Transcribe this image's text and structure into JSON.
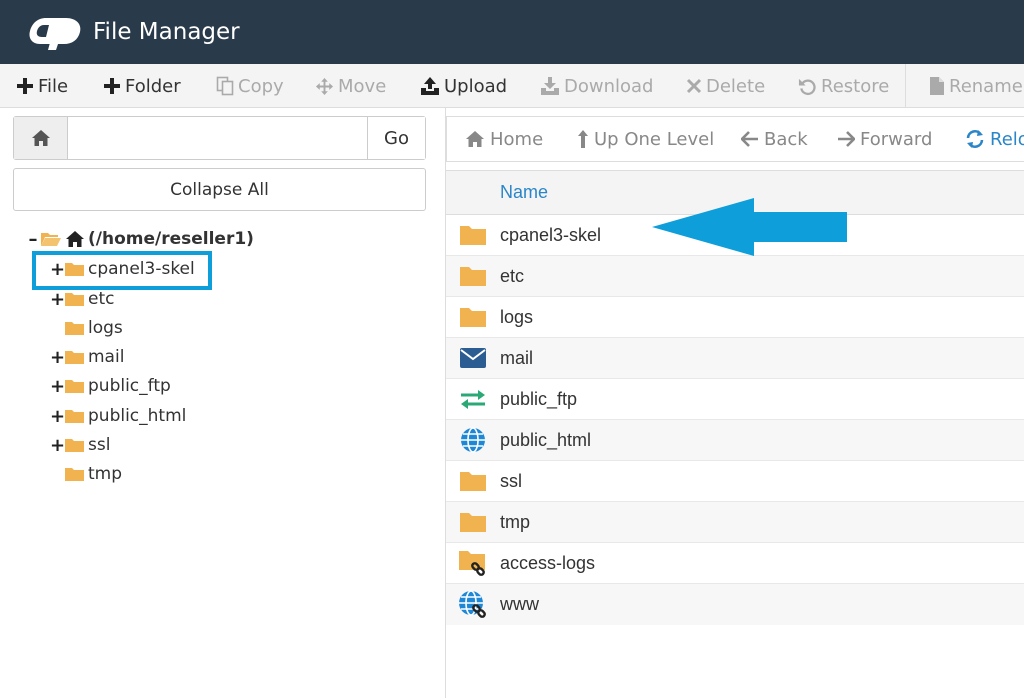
{
  "header": {
    "title": "File Manager"
  },
  "toolbar": {
    "file": "File",
    "folder": "Folder",
    "copy": "Copy",
    "move": "Move",
    "upload": "Upload",
    "download": "Download",
    "delete": "Delete",
    "restore": "Restore",
    "rename": "Rename"
  },
  "search": {
    "value": "",
    "go": "Go"
  },
  "tree": {
    "collapse_all": "Collapse All",
    "root": "(/home/reseller1)",
    "items": [
      "cpanel3-skel",
      "etc",
      "logs",
      "mail",
      "public_ftp",
      "public_html",
      "ssl",
      "tmp"
    ]
  },
  "nav": {
    "home": "Home",
    "up": "Up One Level",
    "back": "Back",
    "forward": "Forward",
    "reload": "Reload"
  },
  "table": {
    "name_header": "Name",
    "rows": [
      "cpanel3-skel",
      "etc",
      "logs",
      "mail",
      "public_ftp",
      "public_html",
      "ssl",
      "tmp",
      "access-logs",
      "www"
    ]
  },
  "colors": {
    "header_bg": "#293a4a",
    "accent": "#2a86c8",
    "folder": "#f0b350",
    "highlight": "#0e9ed9"
  }
}
